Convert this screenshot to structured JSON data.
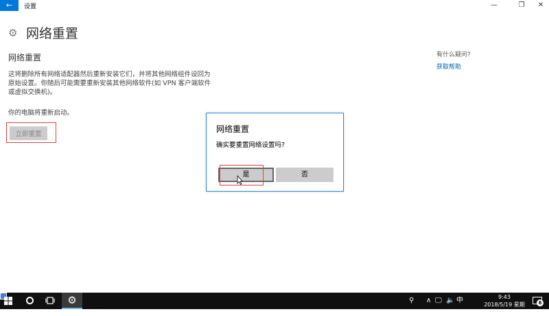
{
  "window": {
    "title": "设置",
    "back_glyph": "←",
    "minimize_glyph": "—",
    "maximize_glyph": "❐",
    "close_glyph": "✕"
  },
  "page": {
    "title": "网络重置",
    "gear_glyph": "⚙"
  },
  "section": {
    "title": "网络重置",
    "description": "这将删除所有网络适配器然后重新安装它们，并将其他网络组件设回为原始设置。你随后可能需要重新安装其他网络软件(如 VPN 客户端软件或虚拟交换机)。",
    "restart_note": "你的电脑将重新启动。",
    "reset_button": "立即重置"
  },
  "help": {
    "question": "有什么疑问?",
    "link": "获取帮助"
  },
  "dialog": {
    "title": "网络重置",
    "message": "确实要重置网络设置吗?",
    "yes": "是",
    "no": "否"
  },
  "taskbar": {
    "settings_glyph": "⚙",
    "people_glyph": "⚲",
    "chevron_glyph": "∧",
    "network_glyph": "🖵",
    "volume_glyph": "🔈",
    "ime": "中",
    "time": "9:43",
    "date": "2018/5/19 星期六",
    "notification_count": "6"
  },
  "colors": {
    "accent": "#0078d7",
    "link": "#0063b1",
    "highlight_box": "#e04040",
    "taskbar": "#101010"
  }
}
